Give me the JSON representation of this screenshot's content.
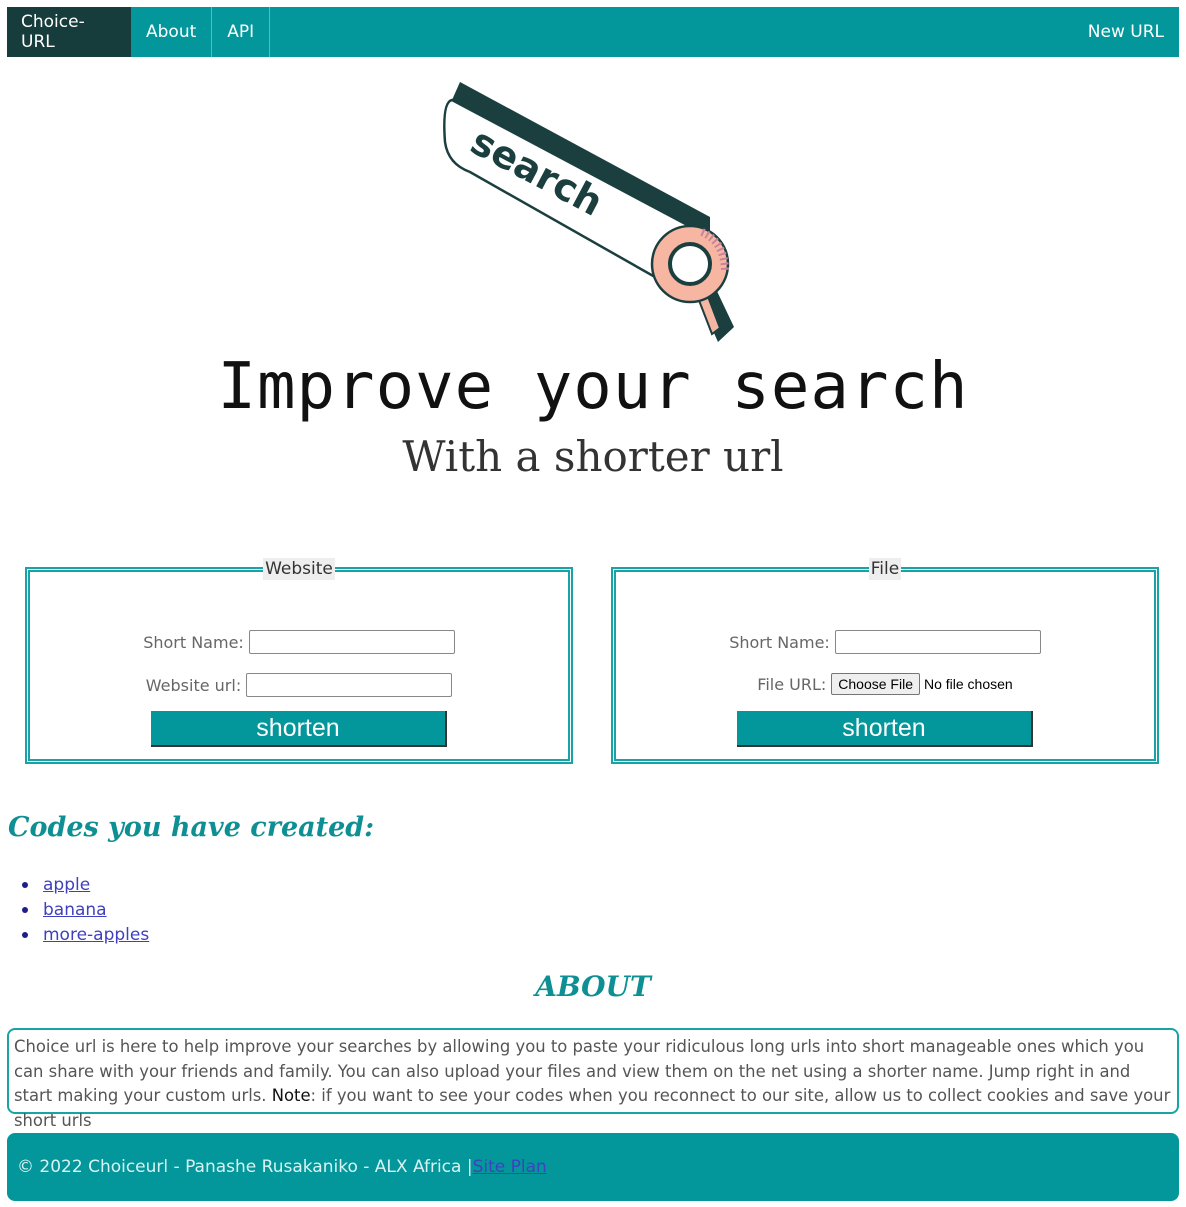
{
  "nav": {
    "brand": "Choice-URL",
    "items": [
      {
        "label": "About"
      },
      {
        "label": "API"
      }
    ],
    "right": "New URL"
  },
  "hero": {
    "art_word": "search",
    "title": "Improve your search",
    "subtitle": "With a shorter url"
  },
  "forms": {
    "website": {
      "legend": "Website",
      "short_name_label": "Short Name:",
      "url_label": "Website url:",
      "submit_label": "shorten"
    },
    "file": {
      "legend": "File",
      "short_name_label": "Short Name:",
      "url_label": "File URL:",
      "choose_label": "Choose File",
      "no_file_text": "No file chosen",
      "submit_label": "shorten"
    }
  },
  "codes": {
    "title": "Codes you have created:",
    "items": [
      "apple",
      "banana",
      "more-apples"
    ]
  },
  "about": {
    "title": "ABOUT",
    "text_before_note": "Choice url is here to help improve your searches by allowing you to paste your ridiculous long urls into short manageable ones which you can share with your friends and family. You can also upload your files and view them on the net using a shorter name. Jump right in and start making your custom urls. ",
    "note_label": "Note",
    "text_after_note": ": if you want to see your codes when you reconnect to our site, allow us to collect cookies and save your short urls"
  },
  "footer": {
    "text": "© 2022 Choiceurl - Panashe Rusakaniko - ALX Africa | ",
    "link": "Site Plan"
  },
  "colors": {
    "primary": "#03979b",
    "brand_bg": "#173c3c",
    "art_dark": "#1b3f3f",
    "art_pink": "#f7b6a2"
  }
}
